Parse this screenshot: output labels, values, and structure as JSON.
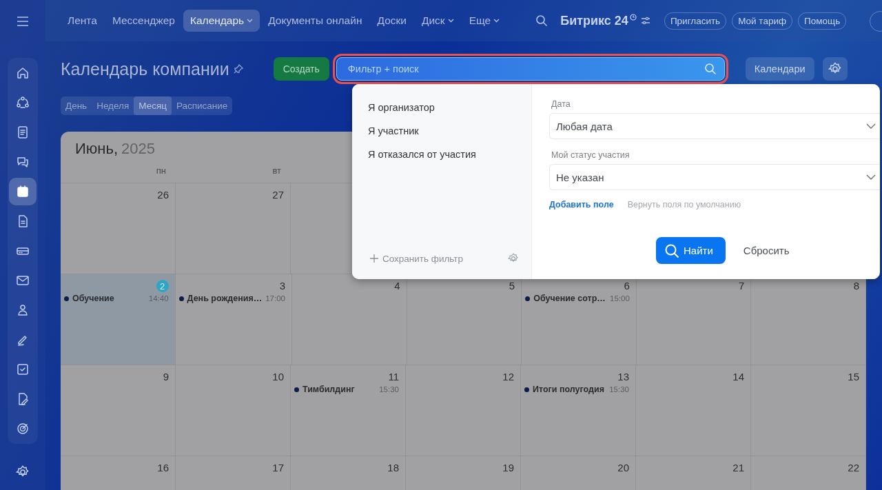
{
  "topbar": {
    "nav": [
      {
        "label": "Лента",
        "selected": false,
        "dropdown": false
      },
      {
        "label": "Мессенджер",
        "selected": false,
        "dropdown": false
      },
      {
        "label": "Календарь",
        "selected": true,
        "dropdown": true
      },
      {
        "label": "Документы онлайн",
        "selected": false,
        "dropdown": false
      },
      {
        "label": "Доски",
        "selected": false,
        "dropdown": false
      },
      {
        "label": "Диск",
        "selected": false,
        "dropdown": true
      },
      {
        "label": "Еще",
        "selected": false,
        "dropdown": true
      }
    ],
    "logo": {
      "name": "Битрикс",
      "suffix": "24"
    },
    "buttons": [
      "Пригласить",
      "Мой тариф",
      "Помощь"
    ]
  },
  "sidebar": {
    "items": [
      {
        "selected": false
      },
      {
        "selected": false
      },
      {
        "selected": false
      },
      {
        "selected": false
      },
      {
        "selected": true
      },
      {
        "selected": false
      },
      {
        "selected": false
      },
      {
        "selected": false
      },
      {
        "selected": false
      },
      {
        "selected": false
      },
      {
        "selected": false
      },
      {
        "selected": false
      },
      {
        "selected": false
      }
    ]
  },
  "header": {
    "title": "Календарь компании",
    "create_button": "Создать",
    "search": {
      "placeholder": "Фильтр + поиск"
    },
    "calendars_button": "Календари"
  },
  "view_tabs": [
    {
      "label": "День",
      "selected": false
    },
    {
      "label": "Неделя",
      "selected": false
    },
    {
      "label": "Месяц",
      "selected": true
    },
    {
      "label": "Расписание",
      "selected": false
    }
  ],
  "calendar": {
    "month": "Июнь,",
    "year": "2025",
    "weekdays": [
      "пн",
      "вт"
    ],
    "weeks": [
      {
        "days": [
          {
            "day": "26",
            "today": false
          },
          {
            "day": "27",
            "today": false
          }
        ]
      },
      {
        "days": [
          {
            "day": "2",
            "today": true,
            "events": [
              {
                "title": "Обучение",
                "time": "14:40",
                "color": "#0d1d4a"
              }
            ]
          },
          {
            "day": "3",
            "today": false,
            "events": [
              {
                "title": "День рождения…",
                "time": "17:00",
                "color": "#0d1d4a"
              }
            ]
          },
          {
            "day": "4",
            "today": false
          },
          {
            "day": "5",
            "today": false
          },
          {
            "day": "6",
            "today": false,
            "events": [
              {
                "title": "Обучение сотр…",
                "time": "15:00",
                "color": "#0d1d4a"
              }
            ]
          },
          {
            "day": "7",
            "today": false
          },
          {
            "day": "8",
            "today": false
          }
        ]
      },
      {
        "days": [
          {
            "day": "9",
            "today": false
          },
          {
            "day": "10",
            "today": false
          },
          {
            "day": "11",
            "today": false,
            "events": [
              {
                "title": "Тимбилдинг",
                "time": "15:30",
                "color": "#0d1d4a"
              }
            ]
          },
          {
            "day": "12",
            "today": false
          },
          {
            "day": "13",
            "today": false,
            "events": [
              {
                "title": "Итоги полугодия",
                "time": "15:30",
                "color": "#0d1d4a"
              }
            ]
          },
          {
            "day": "14",
            "today": false
          },
          {
            "day": "15",
            "today": false
          }
        ]
      },
      {
        "days": [
          {
            "day": "16",
            "today": false
          },
          {
            "day": "17",
            "today": false
          },
          {
            "day": "18",
            "today": false
          },
          {
            "day": "19",
            "today": false
          },
          {
            "day": "20",
            "today": false
          },
          {
            "day": "21",
            "today": false
          },
          {
            "day": "22",
            "today": false
          }
        ]
      }
    ]
  },
  "filter_popup": {
    "presets": [
      "Я организатор",
      "Я участник",
      "Я отказался от участия"
    ],
    "save_filter": "Сохранить фильтр",
    "fields": [
      {
        "label": "Дата",
        "value": "Любая дата"
      },
      {
        "label": "Мой статус участия",
        "value": "Не указан"
      }
    ],
    "add_field": "Добавить поле",
    "restore_fields": "Вернуть поля по умолчанию",
    "find_button": "Найти",
    "reset_button": "Сбросить"
  }
}
